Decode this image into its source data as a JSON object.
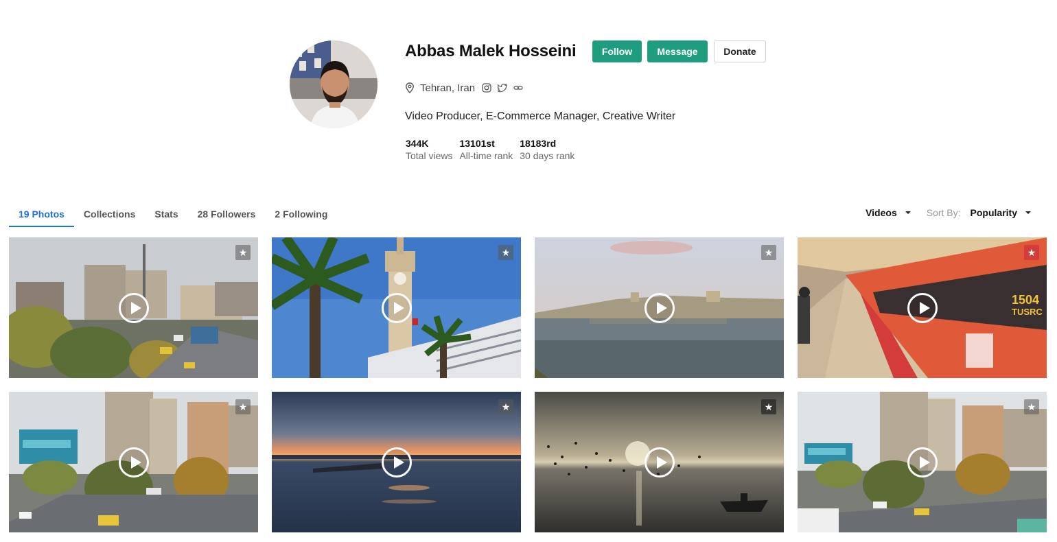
{
  "profile": {
    "name": "Abbas Malek Hosseini",
    "location": "Tehran, Iran",
    "bio": "Video Producer, E-Commerce Manager, Creative Writer",
    "social_icons": [
      "instagram-icon",
      "twitter-icon",
      "link-icon"
    ],
    "buttons": {
      "follow": "Follow",
      "message": "Message",
      "donate": "Donate"
    },
    "stats": [
      {
        "value": "344K",
        "label": "Total views"
      },
      {
        "value": "13101st",
        "label": "All-time rank"
      },
      {
        "value": "18183rd",
        "label": "30 days rank"
      }
    ],
    "accent_color": "#1e9e7e"
  },
  "tabs": [
    {
      "label": "19 Photos",
      "active": true
    },
    {
      "label": "Collections",
      "active": false
    },
    {
      "label": "Stats",
      "active": false
    },
    {
      "label": "28 Followers",
      "active": false
    },
    {
      "label": "2 Following",
      "active": false
    }
  ],
  "filters": {
    "media_type": "Videos",
    "sort_label": "Sort By:",
    "sort_value": "Popularity"
  },
  "videos": [
    {
      "scene": "city-street-rain"
    },
    {
      "scene": "clock-tower-palms"
    },
    {
      "scene": "river-town"
    },
    {
      "scene": "metro-train"
    },
    {
      "scene": "city-buildings-mural"
    },
    {
      "scene": "sunset-sea-pier"
    },
    {
      "scene": "sunrise-sea-birds-boat"
    },
    {
      "scene": "city-buildings-mural-2"
    }
  ],
  "train_sign": "1504\nTUSRC"
}
